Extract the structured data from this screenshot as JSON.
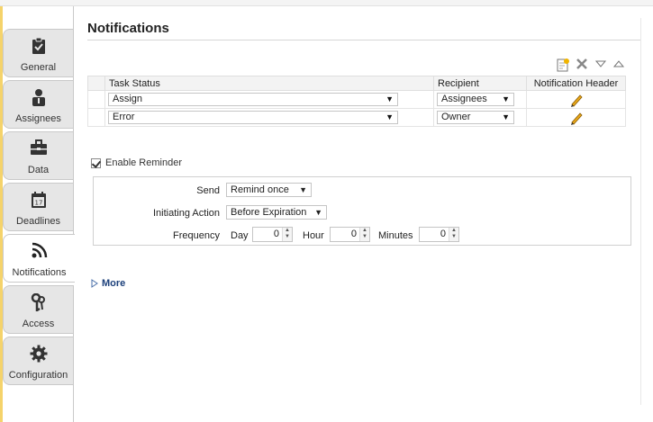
{
  "sidebar": {
    "tabs": [
      {
        "label": "General",
        "icon": "clipboard-check-icon",
        "active": false
      },
      {
        "label": "Assignees",
        "icon": "user-icon",
        "active": false
      },
      {
        "label": "Data",
        "icon": "briefcase-icon",
        "active": false
      },
      {
        "label": "Deadlines",
        "icon": "calendar-icon",
        "active": false
      },
      {
        "label": "Notifications",
        "icon": "rss-icon",
        "active": true
      },
      {
        "label": "Access",
        "icon": "keys-icon",
        "active": false
      },
      {
        "label": "Configuration",
        "icon": "gear-icon",
        "active": false
      }
    ]
  },
  "main": {
    "title": "Notifications",
    "toolbar": {
      "add_icon": "add-notification-icon",
      "delete_icon": "delete-icon",
      "move_down_icon": "move-down-icon",
      "move_up_icon": "move-up-icon"
    },
    "table": {
      "headers": [
        "Task Status",
        "Recipient",
        "Notification Header"
      ],
      "rows": [
        {
          "task_status": "Assign",
          "recipient": "Assignees"
        },
        {
          "task_status": "Error",
          "recipient": "Owner"
        }
      ]
    },
    "reminder": {
      "enable_label": "Enable Reminder",
      "enabled": true,
      "send_label": "Send",
      "send_value": "Remind once",
      "initiating_label": "Initiating Action",
      "initiating_value": "Before Expiration",
      "frequency_label": "Frequency",
      "day_label": "Day",
      "day_value": "0",
      "hour_label": "Hour",
      "hour_value": "0",
      "minutes_label": "Minutes",
      "minutes_value": "0"
    },
    "more_label": "More"
  },
  "colors": {
    "accent_bar": "#f5d36b",
    "more_link": "#1b3f7a",
    "tab_bg": "#e6e6e6"
  }
}
